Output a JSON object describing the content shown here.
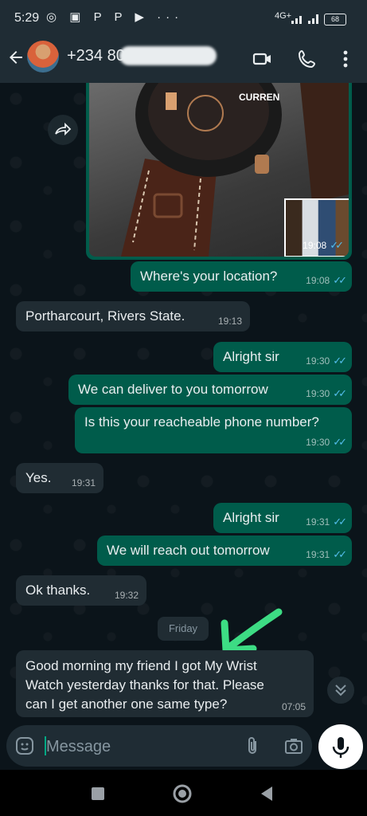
{
  "status": {
    "time": "5:29",
    "network": "4G+",
    "battery": "68"
  },
  "header": {
    "contact": "+234 80"
  },
  "image_message": {
    "time": "19:08"
  },
  "messages": [
    {
      "text": "Where's your location?",
      "time": "19:08"
    },
    {
      "text": "Portharcourt, Rivers State.",
      "time": "19:13"
    },
    {
      "text": "Alright sir",
      "time": "19:30"
    },
    {
      "text": "We can deliver to you tomorrow",
      "time": "19:30"
    },
    {
      "text": "Is this your reacheable phone number?",
      "time": "19:30"
    },
    {
      "text": "Yes.",
      "time": "19:31"
    },
    {
      "text": "Alright sir",
      "time": "19:31"
    },
    {
      "text": "We will reach out tomorrow",
      "time": "19:31"
    },
    {
      "text": "Ok thanks.",
      "time": "19:32"
    },
    {
      "text_lines": [
        "Good morning my friend I got My Wrist",
        "Watch yesterday thanks for that. Please",
        "can I get another one same type?"
      ],
      "time": "07:05"
    }
  ],
  "date_divider": "Friday",
  "composer": {
    "placeholder": "Message"
  }
}
